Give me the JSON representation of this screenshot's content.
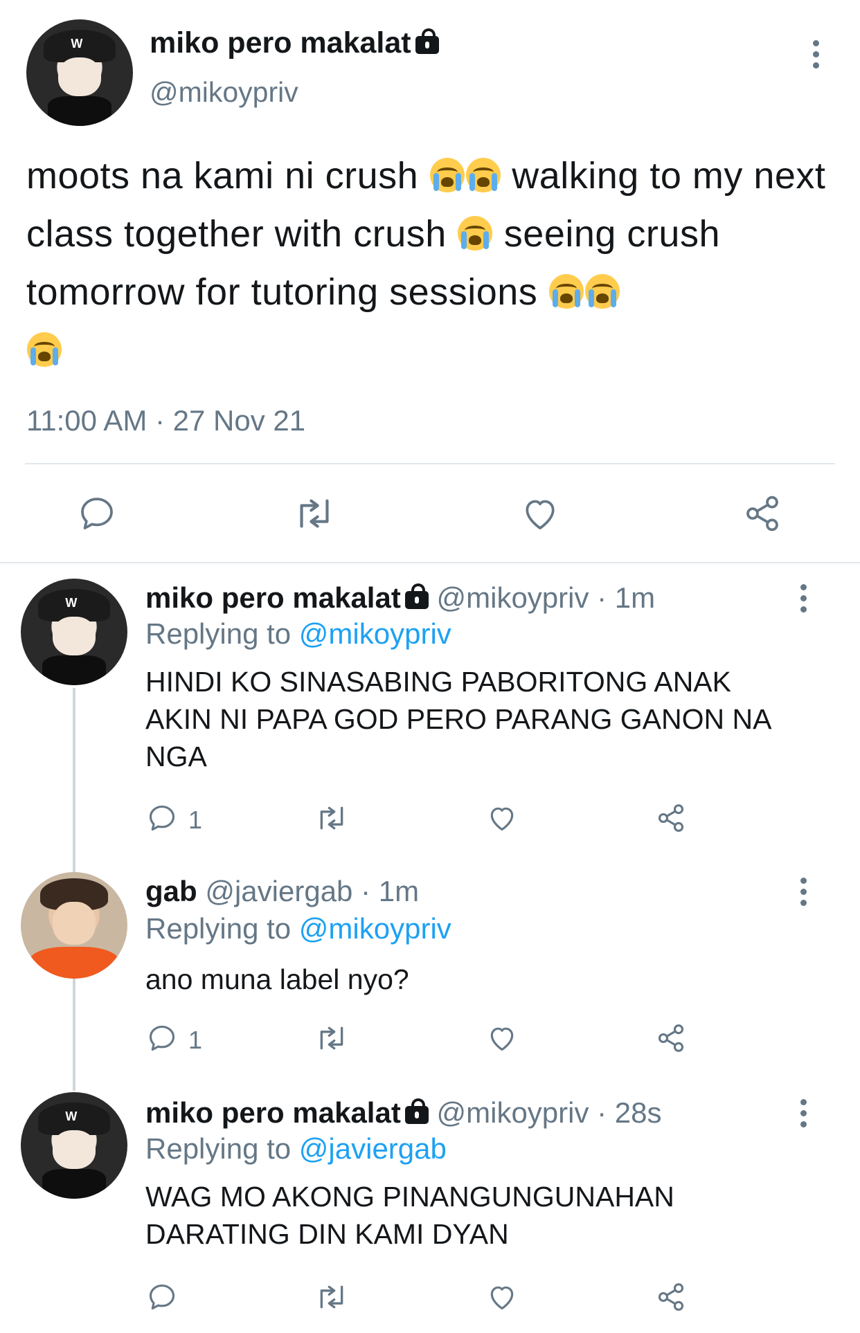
{
  "main_tweet": {
    "author_name": "miko pero makalat",
    "author_handle": "@mikoypriv",
    "text_parts": [
      "moots na kami ni crush",
      "walking to my next class together with crush",
      "seeing crush tomorrow for tutoring sessions"
    ],
    "timestamp": "11:00 AM · 27 Nov 21",
    "icons": [
      "reply-icon",
      "retweet-icon",
      "like-icon",
      "share-icon"
    ]
  },
  "replies": [
    {
      "author_name": "miko pero makalat",
      "author_handle": "@mikoypriv",
      "time": "· 1m",
      "replying_label": "Replying to",
      "replying_to": "@mikoypriv",
      "text": "HINDI KO SINASABING PABORITONG ANAK AKIN NI PAPA GOD PERO PARANG GANON NA NGA",
      "reply_count": "1"
    },
    {
      "author_name": "gab",
      "author_handle": "@javiergab",
      "time": "· 1m",
      "replying_label": "Replying to",
      "replying_to": "@mikoypriv",
      "text": "ano muna label nyo?",
      "reply_count": "1"
    },
    {
      "author_name": "miko pero makalat",
      "author_handle": "@mikoypriv",
      "time": "· 28s",
      "replying_label": "Replying to",
      "replying_to": "@javiergab",
      "text": "WAG MO AKONG PINANGUNGUNAHAN DARATING DIN KAMI DYAN",
      "reply_count": ""
    }
  ],
  "colors": {
    "link": "#1da1f2",
    "muted": "#657786",
    "text": "#14171a",
    "divider": "#e1e8ed"
  }
}
